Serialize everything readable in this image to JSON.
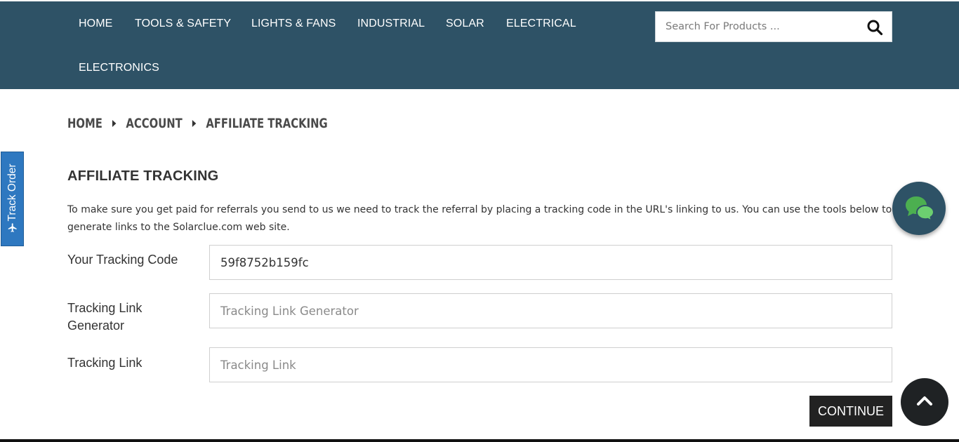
{
  "nav": {
    "items": [
      {
        "label": "HOME"
      },
      {
        "label": "TOOLS & SAFETY"
      },
      {
        "label": "LIGHTS & FANS"
      },
      {
        "label": "INDUSTRIAL"
      },
      {
        "label": "SOLAR"
      },
      {
        "label": "ELECTRICAL"
      },
      {
        "label": "ELECTRONICS"
      }
    ]
  },
  "search": {
    "placeholder": "Search For Products ...",
    "icon": "search-icon"
  },
  "breadcrumb": {
    "items": [
      "HOME",
      "ACCOUNT",
      "AFFILIATE TRACKING"
    ]
  },
  "track_order": {
    "label": "Track Order",
    "icon": "plane-icon"
  },
  "page": {
    "title": "AFFILIATE TRACKING",
    "description": "To make sure you get paid for referrals you send to us we need to track the referral by placing a tracking code in the URL's linking to us. You can use the tools below to generate links to the Solarclue.com web site."
  },
  "form": {
    "tracking_code_label": "Your Tracking Code",
    "tracking_code_value": "59f8752b159fc",
    "generator_label": "Tracking Link Generator",
    "generator_placeholder": "Tracking Link Generator",
    "link_label": "Tracking Link",
    "link_placeholder": "Tracking Link"
  },
  "actions": {
    "continue_label": "CONTINUE"
  },
  "widgets": {
    "chat_icon": "chat-bubbles-icon",
    "scroll_top_icon": "chevron-up-icon"
  },
  "colors": {
    "header_bg": "#2e5266",
    "track_tab_bg": "#2e78c0",
    "chat_accent": "#4caf50",
    "button_dark": "#222222"
  }
}
